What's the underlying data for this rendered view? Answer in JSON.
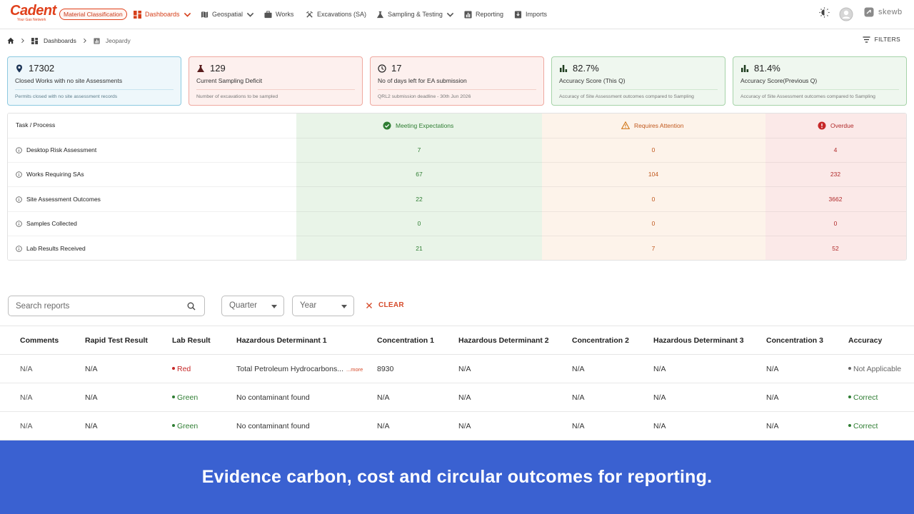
{
  "brand": {
    "name": "Cadent",
    "tagline": "Your Gas Network",
    "badge": "Material Classification",
    "accent": "#e0401b"
  },
  "nav": {
    "items": [
      {
        "label": "Dashboards",
        "icon": "dashboard-icon",
        "active": true,
        "dropdown": true
      },
      {
        "label": "Geospatial",
        "icon": "map-icon",
        "dropdown": true
      },
      {
        "label": "Works",
        "icon": "briefcase-icon"
      },
      {
        "label": "Excavations (SA)",
        "icon": "tools-icon"
      },
      {
        "label": "Sampling & Testing",
        "icon": "flask-icon",
        "dropdown": true
      },
      {
        "label": "Reporting",
        "icon": "chart-icon"
      },
      {
        "label": "Imports",
        "icon": "import-icon"
      }
    ],
    "right": {
      "org": "skewb"
    }
  },
  "breadcrumb": {
    "items": [
      "Dashboards",
      "Jeopardy"
    ]
  },
  "filters_label": "FILTERS",
  "kpis": [
    {
      "value": "17302",
      "label": "Closed Works with no site Assessments",
      "sub": "Permits closed with no site assessment records",
      "icon": "location-pin-icon",
      "tone": "blue"
    },
    {
      "value": "129",
      "label": "Current Sampling Deficit",
      "sub": "Number of excavations to be sampled",
      "icon": "flask-icon",
      "tone": "red"
    },
    {
      "value": "17",
      "label": "No of days left for EA submission",
      "sub": "QRL2 submission deadline - 30th Jun 2026",
      "icon": "clock-icon",
      "tone": "red"
    },
    {
      "value": "82.7%",
      "label": "Accuracy Score (This Q)",
      "sub": "Accuracy of Site Assessment outcomes compared to Sampling",
      "icon": "bar-chart-icon",
      "tone": "green"
    },
    {
      "value": "81.4%",
      "label": "Accuracy Score(Previous Q)",
      "sub": "Accuracy of Site Assessment outcomes compared to Sampling",
      "icon": "bar-chart-icon",
      "tone": "green"
    }
  ],
  "status_table": {
    "headers": [
      "Task / Process",
      "Meeting Expectations",
      "Requires Attention",
      "Overdue"
    ],
    "rows": [
      {
        "task": "Desktop Risk Assessment",
        "meeting": "7",
        "attention": "0",
        "overdue": "4"
      },
      {
        "task": "Works Requiring SAs",
        "meeting": "67",
        "attention": "104",
        "overdue": "232"
      },
      {
        "task": "Site Assessment Outcomes",
        "meeting": "22",
        "attention": "0",
        "overdue": "3662"
      },
      {
        "task": "Samples Collected",
        "meeting": "0",
        "attention": "0",
        "overdue": "0"
      },
      {
        "task": "Lab Results Received",
        "meeting": "21",
        "attention": "7",
        "overdue": "52"
      }
    ]
  },
  "report_controls": {
    "search_placeholder": "Search reports",
    "quarter": "Quarter",
    "year": "Year",
    "clear": "CLEAR"
  },
  "reports_table": {
    "columns": [
      "Comments",
      "Rapid Test Result",
      "Lab Result",
      "Hazardous Determinant 1",
      "Concentration 1",
      "Hazardous Determinant 2",
      "Concentration 2",
      "Hazardous Determinant 3",
      "Concentration 3",
      "Accuracy"
    ],
    "rows": [
      {
        "comments": "N/A",
        "rapid": "N/A",
        "lab": "Red",
        "lab_color": "#c62828",
        "hd1": "Total Petroleum Hydrocarbons...",
        "hd1_more": "...more",
        "c1": "8930",
        "hd2": "N/A",
        "c2": "N/A",
        "hd3": "N/A",
        "c3": "N/A",
        "accuracy": "Not Applicable",
        "accuracy_color": "#666666"
      },
      {
        "comments": "N/A",
        "rapid": "N/A",
        "lab": "Green",
        "lab_color": "#2e7d32",
        "hd1": "No contaminant found",
        "hd1_more": "",
        "c1": "N/A",
        "hd2": "N/A",
        "c2": "N/A",
        "hd3": "N/A",
        "c3": "N/A",
        "accuracy": "Correct",
        "accuracy_color": "#2e7d32"
      },
      {
        "comments": "N/A",
        "rapid": "N/A",
        "lab": "Green",
        "lab_color": "#2e7d32",
        "hd1": "No contaminant found",
        "hd1_more": "",
        "c1": "N/A",
        "hd2": "N/A",
        "c2": "N/A",
        "hd3": "N/A",
        "c3": "N/A",
        "accuracy": "Correct",
        "accuracy_color": "#2e7d32"
      }
    ]
  },
  "banner": {
    "text": "Evidence carbon, cost and circular outcomes for reporting.",
    "color": "#3a61d1"
  }
}
